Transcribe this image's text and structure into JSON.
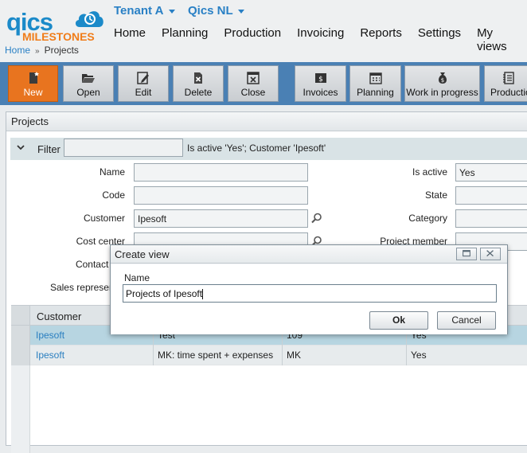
{
  "brand": {
    "qics": "qics",
    "milestones": "MILESTONES"
  },
  "tenants": [
    {
      "label": "Tenant A"
    },
    {
      "label": "Qics NL"
    }
  ],
  "nav": [
    "Home",
    "Planning",
    "Production",
    "Invoicing",
    "Reports",
    "Settings",
    "My views"
  ],
  "breadcrumb": {
    "home": "Home",
    "separator": "»",
    "current": "Projects"
  },
  "toolbar": [
    {
      "label": "New",
      "icon": "new-document-icon"
    },
    {
      "label": "Open",
      "icon": "folder-open-icon"
    },
    {
      "label": "Edit",
      "icon": "pencil-icon"
    },
    {
      "label": "Delete",
      "icon": "delete-document-icon"
    },
    {
      "label": "Close",
      "icon": "close-box-icon"
    },
    {
      "label": "Invoices",
      "icon": "invoice-icon"
    },
    {
      "label": "Planning",
      "icon": "calendar-icon"
    },
    {
      "label": "Work in progress",
      "icon": "money-bag-icon"
    },
    {
      "label": "Production",
      "icon": "notebook-icon"
    }
  ],
  "panel": {
    "title": "Projects"
  },
  "filter": {
    "label": "Filter",
    "value": "",
    "summary": "Is active 'Yes'; Customer 'Ipesoft'"
  },
  "fields_left": [
    {
      "label": "Name",
      "value": ""
    },
    {
      "label": "Code",
      "value": ""
    },
    {
      "label": "Customer",
      "value": "Ipesoft"
    },
    {
      "label": "Cost center",
      "value": ""
    },
    {
      "label": "Contact per",
      "value": ""
    },
    {
      "label": "Sales representat",
      "value": ""
    }
  ],
  "fields_right": [
    {
      "label": "Is active",
      "value": "Yes"
    },
    {
      "label": "State",
      "value": ""
    },
    {
      "label": "Category",
      "value": ""
    },
    {
      "label": "Project member",
      "value": ""
    }
  ],
  "grid": {
    "columns": [
      "Customer"
    ],
    "rows": [
      {
        "customer": "Ipesoft",
        "name": "Test",
        "code": "109",
        "active": "Yes"
      },
      {
        "customer": "Ipesoft",
        "name": "MK: time spent + expenses",
        "code": "MK",
        "active": "Yes"
      }
    ]
  },
  "dialog": {
    "title": "Create view",
    "name_label": "Name",
    "name_value": "Projects of Ipesoft",
    "ok_label": "Ok",
    "cancel_label": "Cancel"
  },
  "colors": {
    "toolbar": "#4a80b4",
    "new_button": "#e8741f",
    "link": "#2980c5",
    "selected_row": "#b7d5e1"
  }
}
